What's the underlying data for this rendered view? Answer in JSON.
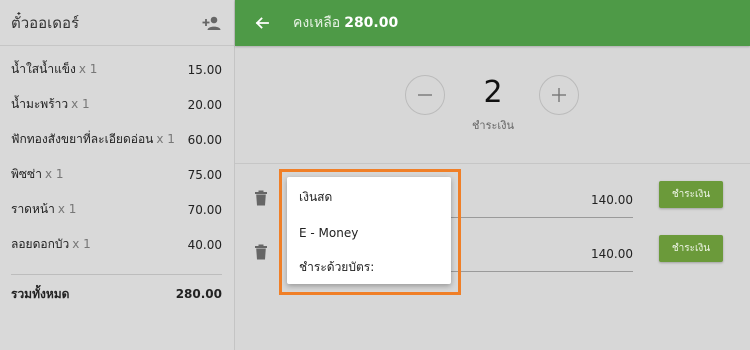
{
  "ticket": {
    "title": "ตั๋วออเดอร์",
    "items": [
      {
        "name": "น้ำใสน้ำแข็ง",
        "qty": "x 1",
        "price": "15.00"
      },
      {
        "name": "น้ำมะพร้าว",
        "qty": "x 1",
        "price": "20.00"
      },
      {
        "name": "ฟักทองสังขยาที่ละเอียดอ่อน",
        "qty": "x 1",
        "price": "60.00"
      },
      {
        "name": "พิซซ่า",
        "qty": "x 1",
        "price": "75.00"
      },
      {
        "name": "ราดหน้า",
        "qty": "x 1",
        "price": "70.00"
      },
      {
        "name": "ลอยดอกบัว",
        "qty": "x 1",
        "price": "40.00"
      }
    ],
    "total_label": "รวมทั้งหมด",
    "total_value": "280.00"
  },
  "header": {
    "balance_label": "คงเหลือ",
    "balance_amount": "280.00",
    "color": "#4e9a47"
  },
  "split": {
    "count": "2",
    "label": "ชำระเงิน"
  },
  "payments": [
    {
      "amount": "140.00",
      "button": "ชำระเงิน"
    },
    {
      "amount": "140.00",
      "button": "ชำระเงิน"
    }
  ],
  "payment_menu": {
    "options": [
      "เงินสด",
      "E - Money",
      "ชำระด้วยบัตร:"
    ]
  },
  "colors": {
    "pay_button": "#6b9a3a",
    "highlight": "#f07f27"
  },
  "icons": {
    "add_person": "person-add-icon",
    "back": "arrow-back-icon",
    "minus": "minus-icon",
    "plus": "plus-icon",
    "trash": "trash-icon"
  }
}
